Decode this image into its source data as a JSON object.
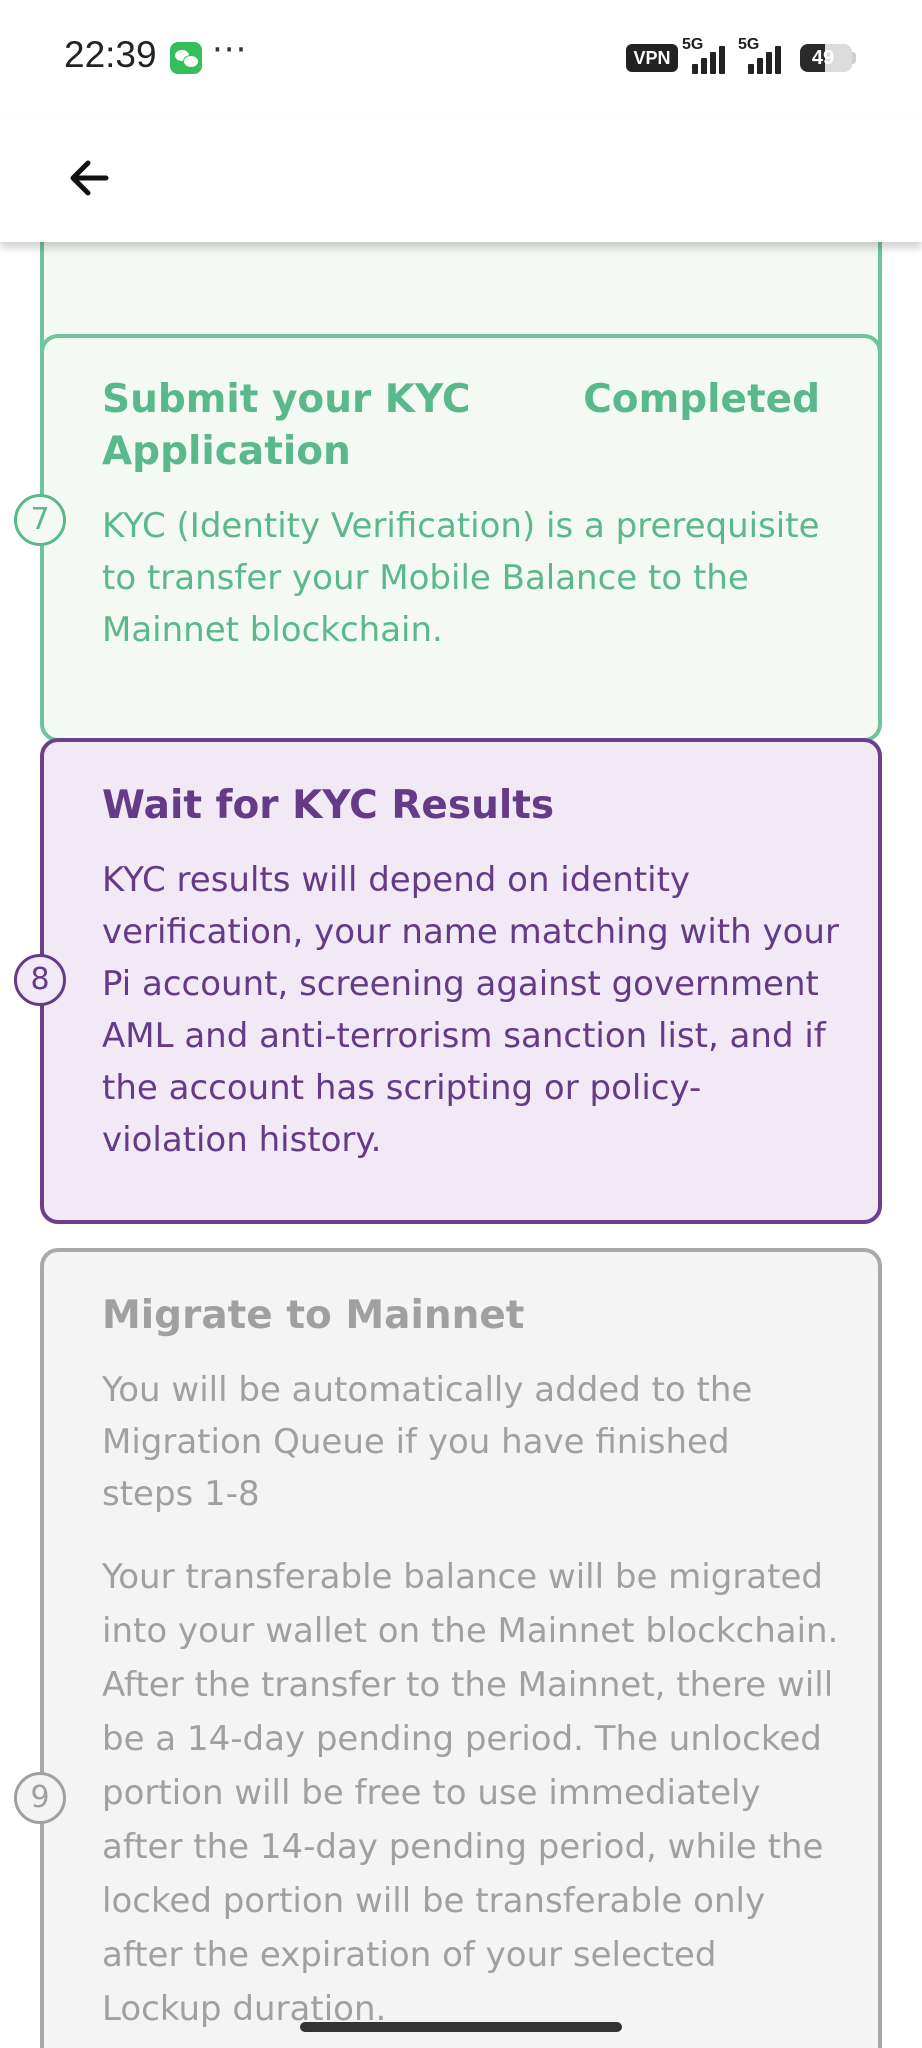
{
  "status_bar": {
    "time": "22:39",
    "vpn_label": "VPN",
    "network_1": "5G",
    "network_2": "5G",
    "battery_level": "49",
    "battery_fraction": 0.49,
    "more_indicator": "···"
  },
  "app_bar": {
    "back_icon": "arrow-left-icon"
  },
  "steps": [
    {
      "number": "7",
      "title": "Submit your KYC Application",
      "status": "Completed",
      "description": "KYC (Identity Verification) is a prerequisite to transfer your Mobile Balance to the Mainnet blockchain.",
      "color": "#59b98a"
    },
    {
      "number": "8",
      "title": "Wait for KYC Results",
      "description": "KYC results will depend on identity verification, your name matching with your Pi account, screening against government AML and anti-terrorism sanction list, and if the account has scripting or policy-violation history.",
      "color": "#653a86"
    },
    {
      "number": "9",
      "title": "Migrate to Mainnet",
      "description": "You will be automatically added to the Migration Queue if you have finished steps 1-8",
      "description_2": "Your transferable balance will be migrated into your wallet on the Mainnet blockchain. After the transfer to the Mainnet, there will be a 14-day pending period. The unlocked portion will be free to use immediately after the 14-day pending period, while the locked portion will be transferable only after the expiration of your selected Lockup duration.",
      "color": "#a0a0a0"
    }
  ]
}
